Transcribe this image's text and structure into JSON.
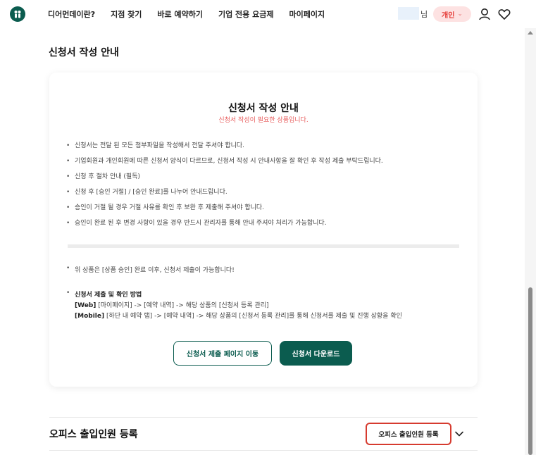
{
  "header": {
    "nav": [
      "디어먼데이란?",
      "지점 찾기",
      "바로 예약하기",
      "기업 전용 요금제",
      "마이페이지"
    ],
    "user_suffix": "님",
    "member_type": "개인",
    "colors": {
      "brand": "#0b5c4f",
      "pill_bg": "#fde2e2",
      "pill_text": "#e53935"
    }
  },
  "section": {
    "title": "신청서 작성 안내"
  },
  "card": {
    "title": "신청서 작성 안내",
    "subtitle": "신청서 작성이 필요한 상품입니다.",
    "bullets": [
      "신청서는 전달 된 모든 첨부파일을 작성해서 전달 주셔야 합니다.",
      "기업회원과 개인회원에 따른 신청서 양식이 다르므로, 신청서 작성 시 안내사항을 잘 확인 후 작성 제출 부탁드립니다.",
      "신청 후 절차 안내 (필독)",
      "신청 후 [승인 거절] / [승인 완료]를 나누어 안내드립니다.",
      "승인이 거절 될 경우 거절 사유를 확인 후 보완 후 제출해 주셔야 합니다.",
      "승인이 완료 된 후 변경 사항이 있을 경우 반드시 관리자를 통해 안내 주셔야 처리가 가능합니다."
    ],
    "note": "위 상품은 [상품 승인] 완료 이후, 신청서 제출이 가능합니다!",
    "method": {
      "title": "신청서 제출 및 확인 방법",
      "web_tag": "[Web]",
      "web_text": " [마이페이지] -> [예약 내역] -> 해당 상품의 [신청서 등록 관리]",
      "mobile_tag": "[Mobile]",
      "mobile_text": " [하단 내 예약 탭] -> [예약 내역] -> 해당 상품의 [신청서 등록 관리]를 통해 신청서를 제출 및 진행 상황을 확인"
    },
    "buttons": {
      "submit_page": "신청서 제출 페이지 이동",
      "download": "신청서 다운로드"
    }
  },
  "accordion": {
    "title": "오피스 출입인원 등록",
    "tag": "오피스 출입인원 등록"
  }
}
